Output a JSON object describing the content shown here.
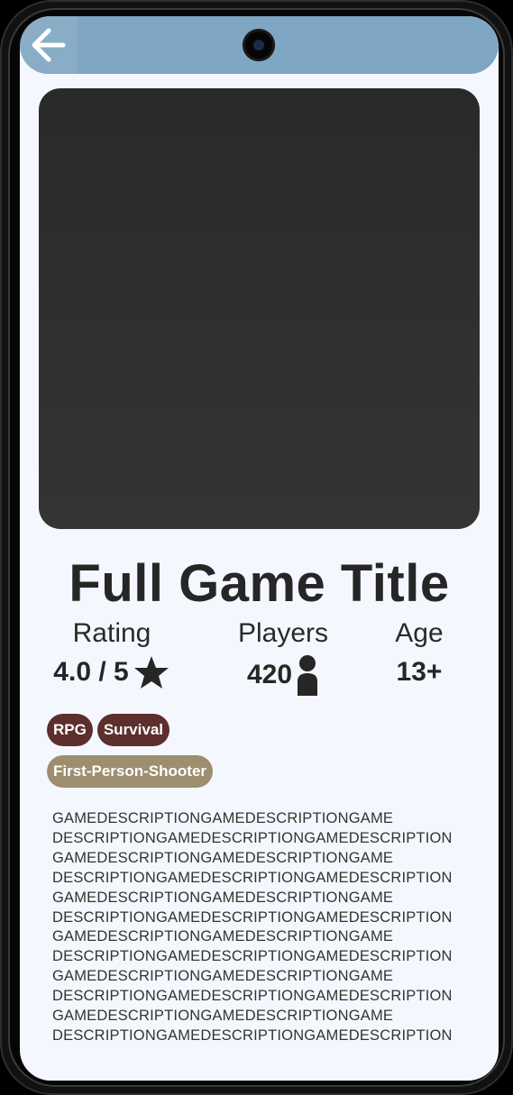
{
  "header": {
    "back_icon": "arrow-left-icon",
    "color": "#7fa6c2"
  },
  "game": {
    "title": "Full Game Title",
    "cover_image": "cover-image-placeholder"
  },
  "stats": {
    "rating": {
      "label": "Rating",
      "value": "4.0 / 5",
      "icon": "star-icon"
    },
    "players": {
      "label": "Players",
      "value": "420",
      "icon": "person-icon"
    },
    "age": {
      "label": "Age",
      "value": "13+"
    }
  },
  "tags": [
    {
      "label": "RPG",
      "color": "#5c2e2c"
    },
    {
      "label": "Survival",
      "color": "#5c2e2c"
    },
    {
      "label": "First-Person-Shooter",
      "color": "#9c8e6f"
    }
  ],
  "description": {
    "lines": [
      "GAMEDESCRIPTIONGAMEDESCRIPTIONGAME",
      "DESCRIPTIONGAMEDESCRIPTIONGAMEDESCRIPTION",
      "GAMEDESCRIPTIONGAMEDESCRIPTIONGAME",
      "DESCRIPTIONGAMEDESCRIPTIONGAMEDESCRIPTION",
      "GAMEDESCRIPTIONGAMEDESCRIPTIONGAME",
      "DESCRIPTIONGAMEDESCRIPTIONGAMEDESCRIPTION",
      "GAMEDESCRIPTIONGAMEDESCRIPTIONGAME",
      "DESCRIPTIONGAMEDESCRIPTIONGAMEDESCRIPTION",
      "GAMEDESCRIPTIONGAMEDESCRIPTIONGAME",
      "DESCRIPTIONGAMEDESCRIPTIONGAMEDESCRIPTION",
      "GAMEDESCRIPTIONGAMEDESCRIPTIONGAME",
      "DESCRIPTIONGAMEDESCRIPTIONGAMEDESCRIPTION"
    ]
  }
}
